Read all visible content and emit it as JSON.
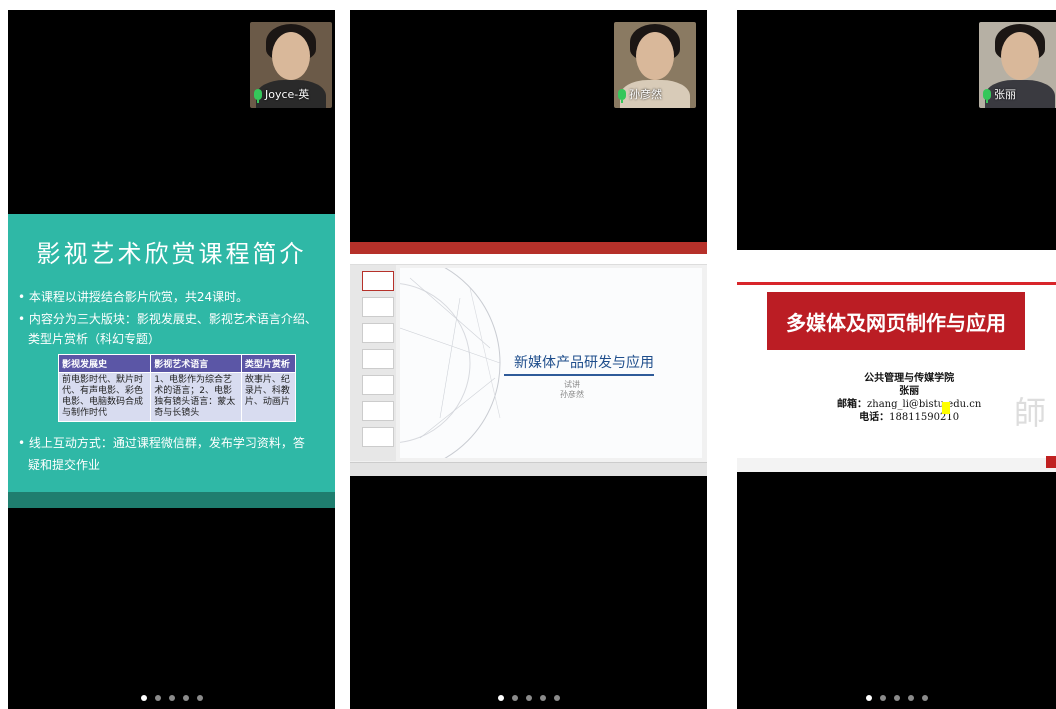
{
  "panel1": {
    "participant": "Joyce-英",
    "slide": {
      "title": "影视艺术欣赏课程简介",
      "bullets": [
        "• 本课程以讲授结合影片欣赏，共24课时。",
        "• 内容分为三大版块：影视发展史、影视艺术语言介绍、",
        "类型片赏析（科幻专题）",
        "• 线上互动方式：通过课程微信群，发布学习资料，答",
        "疑和提交作业"
      ],
      "table_headers": [
        "影视发展史",
        "影视艺术语言",
        "类型片赏析"
      ],
      "table_cells": [
        "前电影时代、默片时代、有声电影、彩色电影、电脑数码合成与制作时代",
        "1、电影作为综合艺术的语言；2、电影独有镜头语言：蒙太奇与长镜头",
        "故事片、纪录片、科教片、动画片"
      ]
    }
  },
  "panel2": {
    "participant": "孙彦然",
    "slide": {
      "title": "新媒体产品研发与应用",
      "sub1": "试讲",
      "sub2": "孙彦然"
    }
  },
  "panel3": {
    "participant": "张丽",
    "slide": {
      "title": "多媒体及网页制作与应用",
      "school": "公共管理与传媒学院",
      "name": "张丽",
      "email_label": "邮箱：",
      "email": "zhang_li@bistu.edu.cn",
      "phone_label": "电话：",
      "phone": "18811590210"
    }
  },
  "colors": {
    "slide1_bg": "#2fb8a6",
    "slide3_banner": "#bb1d24",
    "mic": "#35c75a"
  }
}
